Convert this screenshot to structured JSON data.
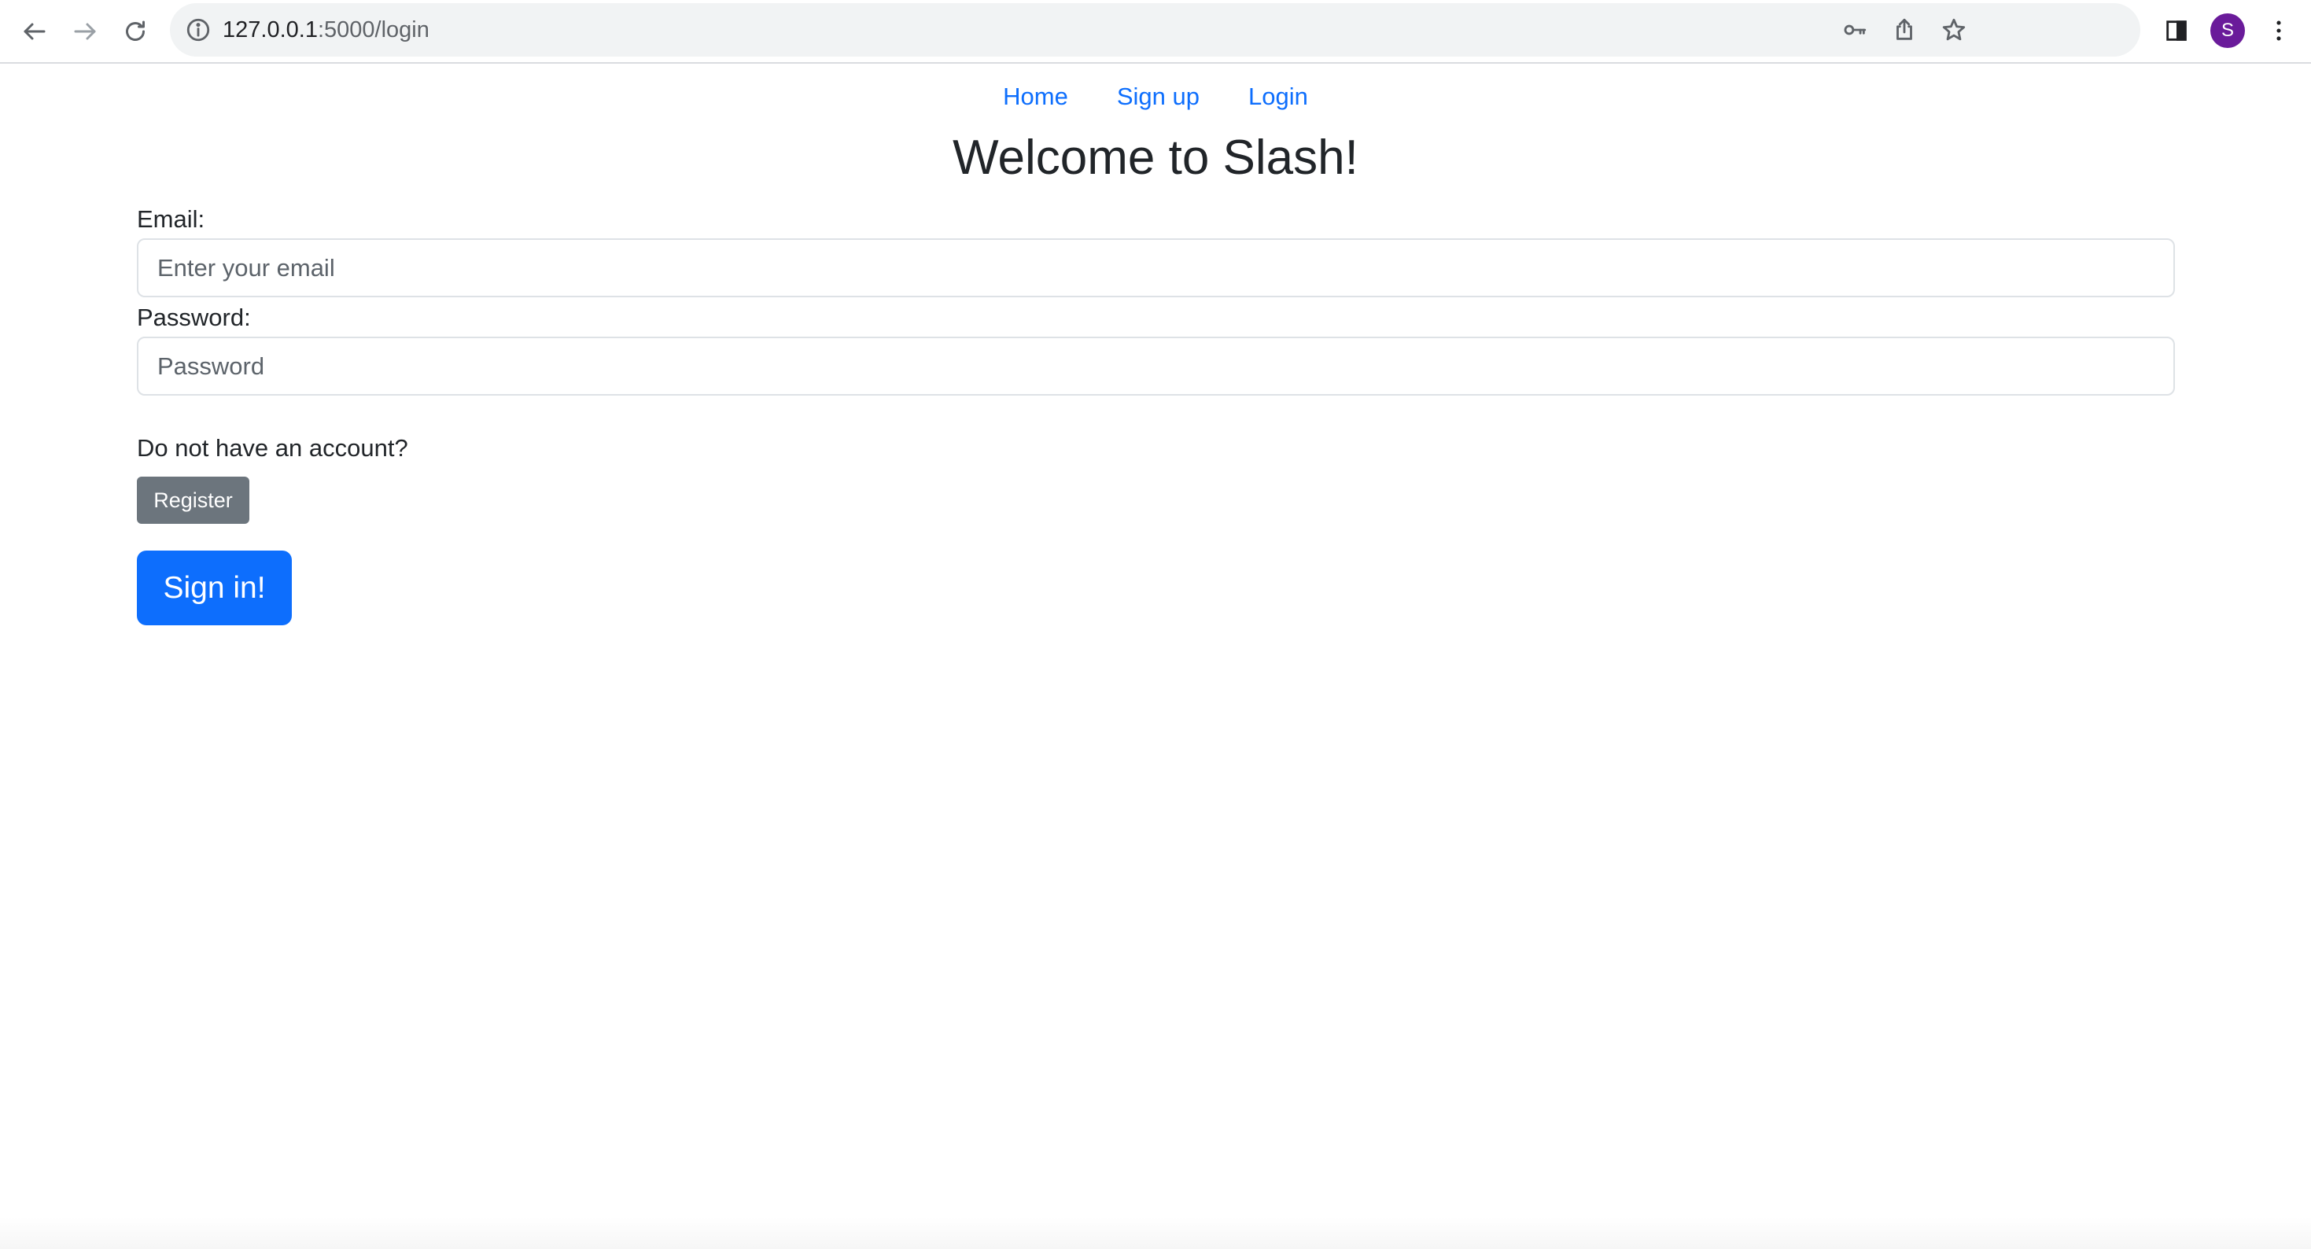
{
  "browser": {
    "url_host": "127.0.0.1",
    "url_path": ":5000/login",
    "profile_initial": "S",
    "icons": {
      "back": "arrow-left-icon",
      "forward": "arrow-right-icon",
      "reload": "reload-icon",
      "site_info": "info-icon",
      "password_key": "key-icon",
      "share": "share-icon",
      "bookmark": "star-icon",
      "side_panel": "side-panel-icon",
      "menu": "kebab-menu-icon"
    },
    "colors": {
      "omnibox_bg": "#f1f3f4",
      "avatar_bg": "#6a1b9a"
    }
  },
  "nav": {
    "items": [
      {
        "label": "Home"
      },
      {
        "label": "Sign up"
      },
      {
        "label": "Login"
      }
    ]
  },
  "page": {
    "title": "Welcome to Slash!"
  },
  "form": {
    "email_label": "Email:",
    "email_placeholder": "Enter your email",
    "password_label": "Password:",
    "password_placeholder": "Password",
    "no_account_text": "Do not have an account?",
    "register_label": "Register",
    "signin_label": "Sign in!"
  },
  "colors": {
    "link": "#0d6efd",
    "primary_button": "#0d6efd",
    "secondary_button": "#6c757d",
    "text": "#212529"
  }
}
